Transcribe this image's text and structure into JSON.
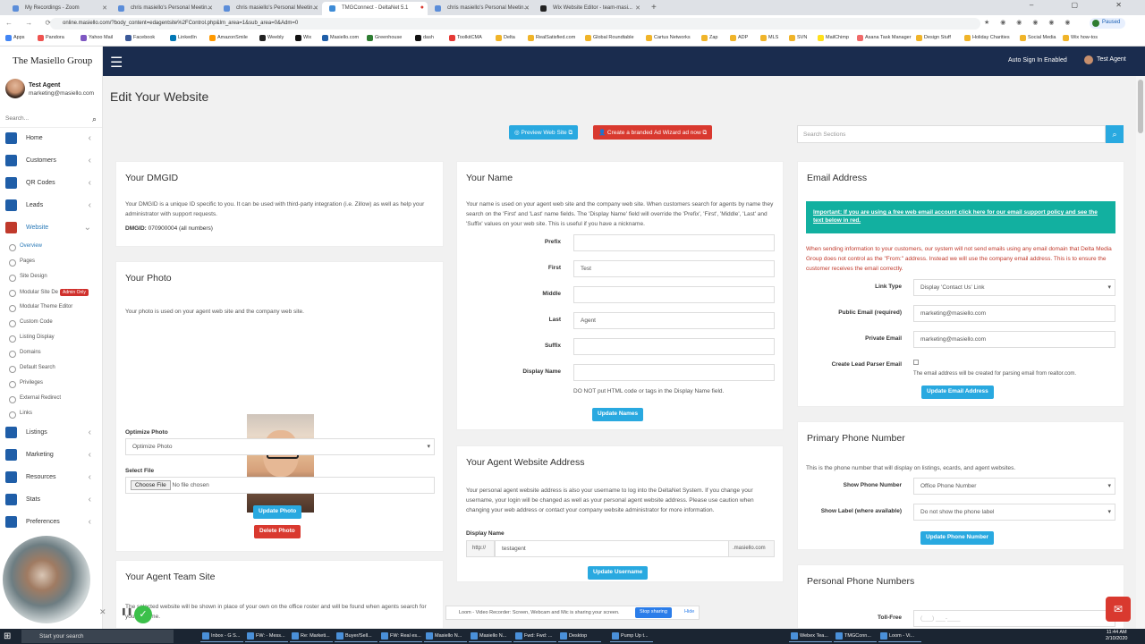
{
  "browser": {
    "tabs": [
      {
        "label": "My Recordings - Zoom",
        "active": false
      },
      {
        "label": "chris masiello's Personal Meetin...",
        "active": false
      },
      {
        "label": "chris masiello's Personal Meetin...",
        "active": false
      },
      {
        "label": "TMGConnect - DeltaNet 5.1",
        "active": true
      },
      {
        "label": "chris masiello's Personal Meetin...",
        "active": false
      },
      {
        "label": "Wix Website Editor - team-masi...",
        "active": false
      }
    ],
    "new_tab": "+",
    "url": "online.masiello.com/?body_content=edagentsite%2FControl.php&lm_area=1&sub_area=0&Adm=0",
    "paused_label": "Paused",
    "window_controls": "– ▢ ✕",
    "bookmarks": [
      "Apps",
      "Pandora",
      "Yahoo Mail",
      "Facebook",
      "LinkedIn",
      "AmazonSmile",
      "Weebly",
      "Wix",
      "Masiello.com",
      "Greenhouse",
      "dash",
      "ToolkitCMA",
      "Delta",
      "RealSatisfied.com",
      "Global Roundtable",
      "Cartus Networks",
      "Zap",
      "ADP",
      "MLS",
      "SVN",
      "MailChimp",
      "Asana Task Manager",
      "Design Stuff",
      "Holiday Charities",
      "Social Media",
      "Wix how-tos"
    ]
  },
  "sidebar": {
    "brand": "The Masiello Group",
    "user_name": "Test Agent",
    "user_email": "marketing@masiello.com",
    "search_placeholder": "Search...",
    "items": [
      {
        "label": "Home",
        "icon": "home-icon",
        "active": false
      },
      {
        "label": "Customers",
        "icon": "users-icon",
        "active": false
      },
      {
        "label": "QR Codes",
        "icon": "qr-icon",
        "active": false
      },
      {
        "label": "Leads",
        "icon": "leads-icon",
        "active": false
      },
      {
        "label": "Website",
        "icon": "globe-icon",
        "active": true
      }
    ],
    "subitems": [
      {
        "label": "Overview",
        "active": true
      },
      {
        "label": "Pages",
        "active": false
      },
      {
        "label": "Site Design",
        "active": false
      },
      {
        "label": "Modular Site De",
        "badge": "Admin Only",
        "active": false
      },
      {
        "label": "Modular Theme Editor",
        "active": false
      },
      {
        "label": "Custom Code",
        "active": false
      },
      {
        "label": "Listing Display",
        "active": false
      },
      {
        "label": "Domains",
        "active": false
      },
      {
        "label": "Default Search",
        "active": false
      },
      {
        "label": "Privileges",
        "active": false
      },
      {
        "label": "External Redirect",
        "active": false
      },
      {
        "label": "Links",
        "active": false
      }
    ],
    "items2": [
      {
        "label": "Listings",
        "icon": "listings-icon"
      },
      {
        "label": "Marketing",
        "icon": "megaphone-icon"
      },
      {
        "label": "Resources",
        "icon": "wrench-icon"
      },
      {
        "label": "Stats",
        "icon": "chart-icon"
      },
      {
        "label": "Preferences",
        "icon": "sliders-icon"
      }
    ]
  },
  "topbar": {
    "auto_sign_in": "Auto Sign In Enabled",
    "user": "Test Agent"
  },
  "main": {
    "title": "Edit Your Website",
    "preview_button": "Preview Web Site",
    "adwizard_button": "Create a branded Ad Wizard ad now",
    "search_sections_placeholder": "Search Sections",
    "dmgid": {
      "title": "Your DMGID",
      "desc": "Your DMGID is a unique ID specific to you. It can be used with third-party integration (i.e. Zillow) as well as help your administrator with support requests.",
      "label": "DMGID:",
      "value": "070900004",
      "suffix": "(all numbers)"
    },
    "photo": {
      "title": "Your Photo",
      "desc": "Your photo is used on your agent web site and the company web site.",
      "optimize_label": "Optimize Photo",
      "optimize_value": "Optimize Photo",
      "select_file_label": "Select File",
      "choose_file": "Choose File",
      "no_file": "No file chosen",
      "update_button": "Update Photo",
      "delete_button": "Delete Photo"
    },
    "team": {
      "title": "Your Agent Team Site",
      "desc": "The selected website will be shown in place of your own on the office roster and will be found when agents search for you by name."
    },
    "name": {
      "title": "Your Name",
      "desc": "Your name is used on your agent web site and the company web site. When customers search for agents by name they search on the 'First' and 'Last' name fields. The 'Display Name' field will override the 'Prefix', 'First', 'Middle', 'Last' and 'Suffix' values on your web site. This is useful if you have a nickname.",
      "fields": [
        {
          "label": "Prefix",
          "value": ""
        },
        {
          "label": "First",
          "value": "Test"
        },
        {
          "label": "Middle",
          "value": ""
        },
        {
          "label": "Last",
          "value": "Agent"
        },
        {
          "label": "Suffix",
          "value": ""
        },
        {
          "label": "Display Name",
          "value": ""
        }
      ],
      "html_note": "DO NOT put HTML code or tags in the Display Name field.",
      "update_button": "Update Names"
    },
    "address": {
      "title": "Your Agent Website Address",
      "desc": "Your personal agent website address is also your username to log into the DeltaNet System. If you change your username, your login will be changed as well as your personal agent website address. Please use caution when changing your web address or contact your company website administrator for more information.",
      "display_name_label": "Display Name",
      "prefix": "http://",
      "value": "testagent",
      "suffix": ".masiello.com",
      "update_button": "Update Username"
    },
    "email": {
      "title": "Email Address",
      "notice": "Important: If you are using a free web email account click here for our email support policy and see the text below in red.",
      "warning": "When sending information to your customers, our system will not send emails using any email domain that Delta Media Group does not control as the \"From:\" address. Instead we will use the company email address. This is to ensure the customer receives the email correctly.",
      "link_type_label": "Link Type",
      "link_type_value": "Display 'Contact Us' Link",
      "public_label": "Public Email (required)",
      "public_value": "marketing@masiello.com",
      "private_label": "Private Email",
      "private_value": "marketing@masiello.com",
      "lead_parser_label": "Create Lead Parser Email",
      "lead_parser_note": "The email address will be created for parsing email from realtor.com.",
      "update_button": "Update Email Address"
    },
    "phone": {
      "title": "Primary Phone Number",
      "desc": "This is the phone number that will display on listings, ecards, and agent websites.",
      "show_label": "Show Phone Number",
      "show_value": "Office Phone Number",
      "label_label": "Show Label (where available)",
      "label_value": "Do not show the phone label",
      "update_button": "Update Phone Number"
    },
    "personal_phone": {
      "title": "Personal Phone Numbers",
      "tollfree_label": "Toll-Free",
      "tollfree_placeholder": "(___) ___-____"
    }
  },
  "loom": {
    "message": "Loom - Video Recorder: Screen, Webcam and Mic is sharing your screen.",
    "stop": "Stop sharing",
    "hide": "Hide"
  },
  "taskbar": {
    "search": "Start your search",
    "apps": [
      "Inbox - G S...",
      "FW: - Mess...",
      "Re: Marketi...",
      "Buyer/Sell...",
      "FW: Real es...",
      "Masiello N...",
      "Masiello N...",
      "Fwd: Fwd: ...",
      "Desktop",
      "Pump Up t...",
      "Webex Tea...",
      "TMGConn...",
      "Loom - Vi..."
    ],
    "time": "11:44 AM",
    "date": "2/10/2020"
  },
  "colors": {
    "nav": "#1a2c4e",
    "accent": "#29a9e0",
    "danger": "#d9392f",
    "notice": "#12b0a0"
  }
}
